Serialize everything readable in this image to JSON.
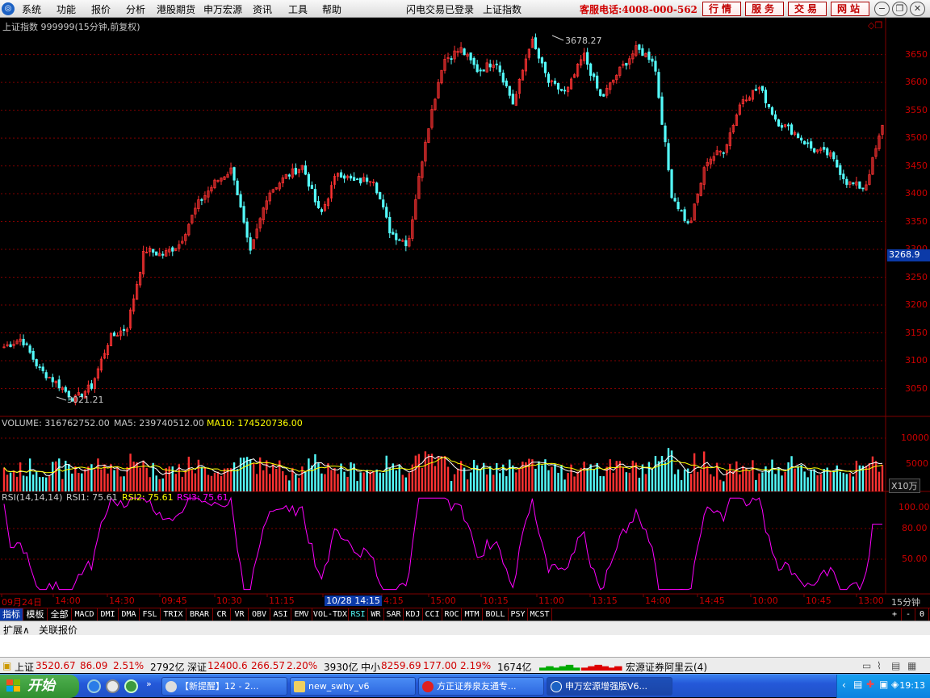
{
  "menu": {
    "items": [
      "系统",
      "功能",
      "报价",
      "分析",
      "港股期货",
      "申万宏源",
      "资讯",
      "工具",
      "帮助"
    ],
    "login_status": "闪电交易已登录",
    "center_title": "上证指数",
    "hotline": "客服电话:4008-000-562",
    "buttons": [
      "行情",
      "服务",
      "交易",
      "网站"
    ]
  },
  "chart": {
    "title": "上证指数 999999(15分钟,前复权)",
    "high_label": "3678.27",
    "low_label": "3021.21",
    "price_axis": [
      "3650",
      "3600",
      "3550",
      "3500",
      "3450",
      "3400",
      "3350",
      "3300",
      "3250",
      "3200",
      "3150",
      "3100",
      "3050"
    ],
    "current_price": "3268.9",
    "volume_label": "VOLUME: 316762752.00",
    "ma5_label": "MA5: 239740512.00",
    "ma10_label": "MA10: 174520736.00",
    "volume_axis": [
      "10000",
      "5000"
    ],
    "volume_unit": "X10万",
    "rsi_label": "RSI(14,14,14)",
    "rsi1_label": "RSI1: 75.61",
    "rsi2_label": "RSI2: 75.61",
    "rsi3_label": "RSI3: 75.61",
    "rsi_axis": [
      "100.00",
      "80.00",
      "50.00"
    ],
    "time_axis": [
      "09月24日",
      "14:00",
      "14:30",
      "09:45",
      "10:30",
      "11:15",
      "10/28 14:15",
      "4:15",
      "15:00",
      "10:15",
      "11:00",
      "13:15",
      "14:00",
      "14:45",
      "10:00",
      "10:45",
      "13:00"
    ],
    "period": "15分钟"
  },
  "chart_data": {
    "type": "candlestick",
    "title": "上证指数 999999(15分钟,前复权)",
    "ylim": [
      3000,
      3690
    ],
    "high": 3678.27,
    "low": 3021.21,
    "last": 3520.67,
    "waypoints": [
      3125,
      3140,
      3085,
      3060,
      3030,
      3055,
      3140,
      3160,
      3300,
      3290,
      3310,
      3380,
      3420,
      3445,
      3290,
      3400,
      3430,
      3450,
      3360,
      3440,
      3420,
      3430,
      3330,
      3310,
      3500,
      3640,
      3660,
      3620,
      3640,
      3560,
      3678,
      3600,
      3580,
      3650,
      3570,
      3620,
      3660,
      3640,
      3400,
      3340,
      3460,
      3480,
      3570,
      3590,
      3530,
      3510,
      3480,
      3470,
      3420,
      3410,
      3520
    ],
    "volume_ylim": [
      0,
      11000
    ],
    "rsi_ylim": [
      30,
      100
    ]
  },
  "tabs": [
    "指标",
    "模板",
    "全部",
    "MACD",
    "DMI",
    "DMA",
    "FSL",
    "TRIX",
    "BRAR",
    "CR",
    "VR",
    "OBV",
    "ASI",
    "EMV",
    "VOL-TDX",
    "RSI",
    "WR",
    "SAR",
    "KDJ",
    "CCI",
    "ROC",
    "MTM",
    "BOLL",
    "PSY",
    "MCST"
  ],
  "tab_right": [
    "+",
    "-",
    "0"
  ],
  "ext": [
    "扩展∧",
    "关联报价"
  ],
  "quotes": {
    "sh_name": "上证",
    "sh_price": "3520.67",
    "sh_change": "86.09",
    "sh_pct": "2.51%",
    "sh_amount": "2792亿",
    "sz_name": "深证",
    "sz_price": "12400.6",
    "sz_change": "266.57",
    "sz_pct": "2.20%",
    "sz_amount": "3930亿",
    "zx_name": "中小",
    "zx_price": "8259.69",
    "zx_change": "177.00",
    "zx_pct": "2.19%",
    "zx_amount": "1674亿",
    "broker": "宏源证券阿里云(4)"
  },
  "taskbar": {
    "start": "开始",
    "items": [
      "【新提醒】12 - 2...",
      "new_swhy_v6",
      "方正证券泉友通专...",
      "申万宏源增强版V6..."
    ],
    "clock": "19:13"
  },
  "colors": {
    "up": "#ff3232",
    "down": "#54fcfc",
    "grid": "#800000",
    "rsi": "#ff00ff"
  }
}
